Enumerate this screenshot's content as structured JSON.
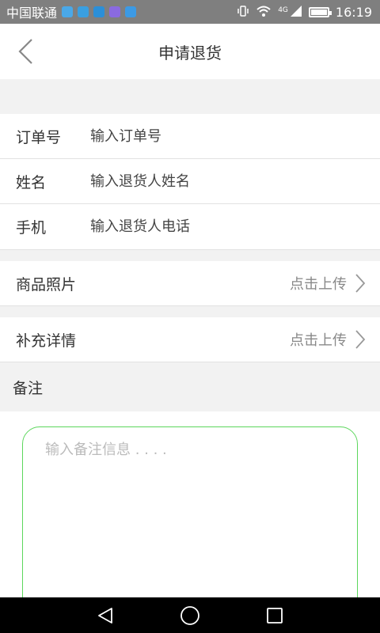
{
  "status_bar": {
    "carrier": "中国联通",
    "network_type": "4G",
    "time": "16:19",
    "icons": [
      "vibrate-icon",
      "wifi-icon",
      "signal-icon",
      "battery-icon"
    ],
    "app_icons": [
      "qq-notification-icon",
      "health-app-icon",
      "gallery-app-icon",
      "message-app-icon",
      "wifi-app-icon"
    ]
  },
  "header": {
    "title": "申请退货",
    "back_icon": "chevron-left-icon"
  },
  "form": {
    "order_no": {
      "label": "订单号",
      "placeholder": "输入订单号"
    },
    "name": {
      "label": "姓名",
      "placeholder": "输入退货人姓名"
    },
    "phone": {
      "label": "手机",
      "placeholder": "输入退货人电话"
    }
  },
  "uploads": {
    "photos": {
      "label": "商品照片",
      "action": "点击上传"
    },
    "details": {
      "label": "补充详情",
      "action": "点击上传"
    }
  },
  "remark": {
    "title": "备注",
    "placeholder": "输入备注信息 . . . ."
  },
  "colors": {
    "accent_border": "#5cd65c",
    "band": "#f2f2f2",
    "text": "#333333"
  }
}
